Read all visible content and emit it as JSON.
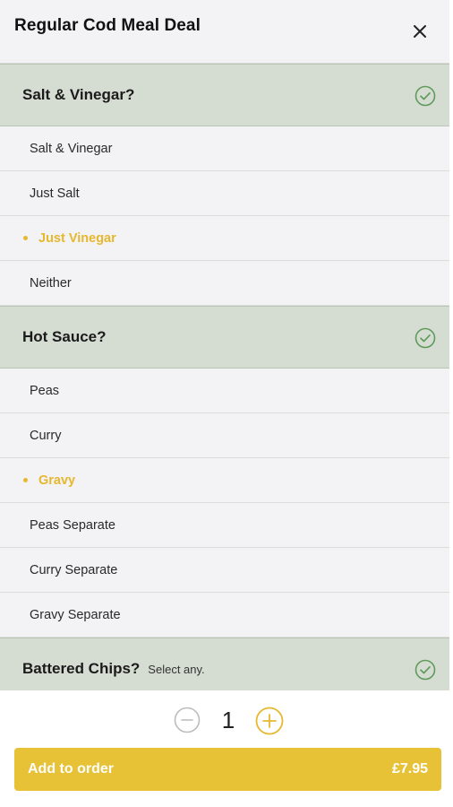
{
  "header": {
    "title": "Regular Cod Meal Deal",
    "close_icon": "close-icon"
  },
  "sections": [
    {
      "title": "Salt & Vinegar?",
      "note": "",
      "options": [
        {
          "label": "Salt & Vinegar",
          "selected": false
        },
        {
          "label": "Just Salt",
          "selected": false
        },
        {
          "label": "Just Vinegar",
          "selected": true
        },
        {
          "label": "Neither",
          "selected": false
        }
      ]
    },
    {
      "title": "Hot Sauce?",
      "note": "",
      "options": [
        {
          "label": "Peas",
          "selected": false
        },
        {
          "label": "Curry",
          "selected": false
        },
        {
          "label": "Gravy",
          "selected": true
        },
        {
          "label": "Peas Separate",
          "selected": false
        },
        {
          "label": "Curry Separate",
          "selected": false
        },
        {
          "label": "Gravy Separate",
          "selected": false
        }
      ]
    },
    {
      "title": "Battered Chips?",
      "note": "Select any.",
      "options": []
    }
  ],
  "footer": {
    "quantity": "1",
    "add_label": "Add to order",
    "price": "£7.95"
  },
  "colors": {
    "accent": "#e7c236",
    "selected_text": "#e6b82e",
    "section_bg": "#d5ddd3",
    "check_green": "#5f9a5a",
    "page_bg": "#f3f2f5"
  }
}
